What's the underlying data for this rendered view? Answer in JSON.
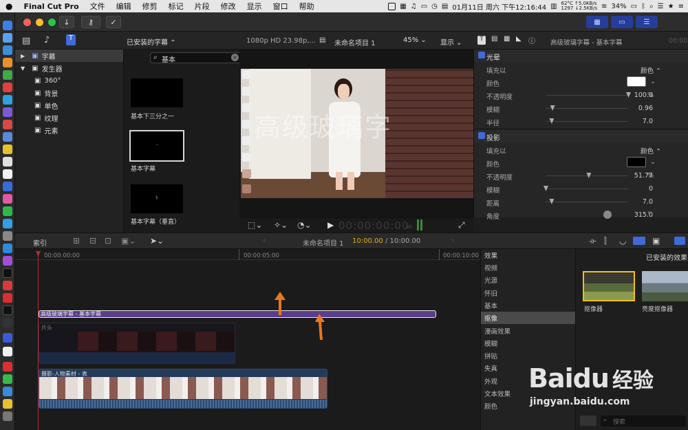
{
  "menubar": {
    "app_name": "Final Cut Pro",
    "items": [
      "文件",
      "编辑",
      "修剪",
      "标记",
      "片段",
      "修改",
      "显示",
      "窗口",
      "帮助"
    ],
    "status": {
      "temp": "62°C",
      "fan": "1297",
      "net_up": "↑5.0KB/s",
      "net_down": "↓2.5KB/s",
      "clock": "01月11日 周六 下午12:16:44",
      "battery": "34%"
    }
  },
  "browser": {
    "filter_label": "已安装的字幕",
    "filter_chevron": "⌃",
    "search_value": "基本",
    "sidebar": {
      "titles": "字幕",
      "generators": "发生器",
      "items": [
        "360°",
        "背景",
        "单色",
        "纹理",
        "元素"
      ]
    },
    "clips": [
      {
        "label": "基本下三分之一"
      },
      {
        "label": "基本字幕"
      },
      {
        "label": "基本字幕（垂直）"
      }
    ]
  },
  "viewer": {
    "format": "1080p HD 23.98p,...",
    "project": "未命名项目 1",
    "zoom": "45%",
    "display_menu": "显示",
    "overlay_text": "高级玻璃字",
    "timecode": "00:00:00:00",
    "timecode_suffix": "00"
  },
  "inspector": {
    "title": "高级玻璃字幕 - 基本字幕",
    "time": "00:00",
    "glow": {
      "name": "光晕",
      "fill_label": "填充以",
      "fill_value": "颜色",
      "color_label": "颜色",
      "color": "#ffffff",
      "opacity_label": "不透明度",
      "opacity": "100.0",
      "opacity_level": 1.0,
      "blur_label": "模糊",
      "blur": "0.96",
      "blur_level": 0.08,
      "radius_label": "半径",
      "radius": "7.0",
      "radius_level": 0.07
    },
    "shadow": {
      "name": "投影",
      "fill_label": "填充以",
      "fill_value": "颜色",
      "color_label": "颜色",
      "color": "#000000",
      "opacity_label": "不透明度",
      "opacity": "51.77",
      "opacity_level": 0.52,
      "blur_label": "模糊",
      "blur": "0",
      "blur_level": 0.0,
      "distance_label": "距离",
      "distance": "7.0",
      "distance_level": 0.07,
      "angle_label": "角度",
      "angle": "315.0"
    },
    "percent": "%",
    "degree": "°"
  },
  "timeline": {
    "index_label": "索引",
    "project": "未命名项目 1",
    "position": "10:00.00",
    "duration": "/ 10:00.00",
    "ruler": [
      "00:00:00:00",
      "00:00:05:00",
      "00:00:10:00"
    ],
    "title_clip": "高级玻璃字幕 - 基本字幕",
    "opening_clip": "片头",
    "main_clip": "摄影-人物素材 - 表"
  },
  "effects": {
    "header": "效果",
    "installed": "已安装的效果",
    "categories": [
      "视频",
      "光源",
      "怀旧",
      "基本",
      "抠像",
      "漫画效果",
      "模糊",
      "拼贴",
      "失真",
      "外观",
      "文本效果",
      "颜色"
    ],
    "selected_index": 4,
    "thumbs": [
      "抠像器",
      "亮度抠像器"
    ],
    "search_placeholder": "搜索"
  },
  "watermark": {
    "brand": "Baidu",
    "site": "jingyan.baidu.com",
    "cn": "经验"
  },
  "colors": {
    "accent": "#3f6bd8",
    "title_clip": "#5a3e8a",
    "orange": "#e8781e",
    "selected_outline": "#f0c020"
  }
}
